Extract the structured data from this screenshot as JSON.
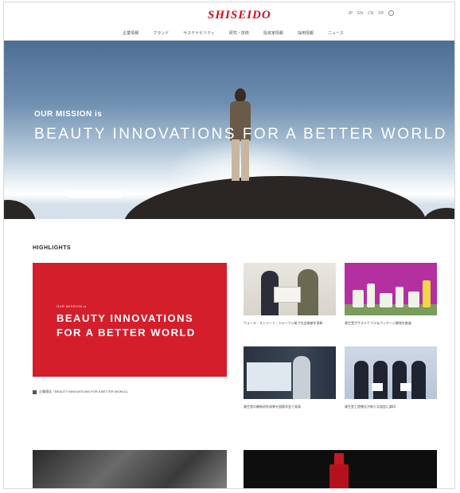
{
  "brand": {
    "logo": "SHISEIDO",
    "accent": "#d10e1e"
  },
  "header": {
    "utility": [
      "JP",
      "EN",
      "CN",
      "FR"
    ],
    "nav": [
      "企業情報",
      "ブランド",
      "サステナビリティ",
      "研究・技術",
      "投資家情報",
      "採用情報",
      "ニュース"
    ]
  },
  "hero": {
    "eyebrow": "OUR MISSION is",
    "headline": "BEAUTY INNOVATIONS FOR A BETTER WORLD"
  },
  "highlights": {
    "title": "HIGHLIGHTS",
    "feature": {
      "eyebrow": "OUR MISSION is",
      "line1": "BEAUTY INNOVATIONS",
      "line2": "FOR A BETTER WORLD",
      "caption": "企業理念「BEAUTY INNOVATIONS FOR A BETTER WORLD」"
    },
    "cards": [
      {
        "caption": "ウォール・ストリート・ジャーナル紙で社会貢献を表彰"
      },
      {
        "caption": "資生堂がサステナブルなパッケージ開発を推進"
      },
      {
        "caption": "資生堂の最新研究成果を国際学会で発表"
      },
      {
        "caption": "資生堂と提携先が新たな協定に調印"
      }
    ]
  }
}
